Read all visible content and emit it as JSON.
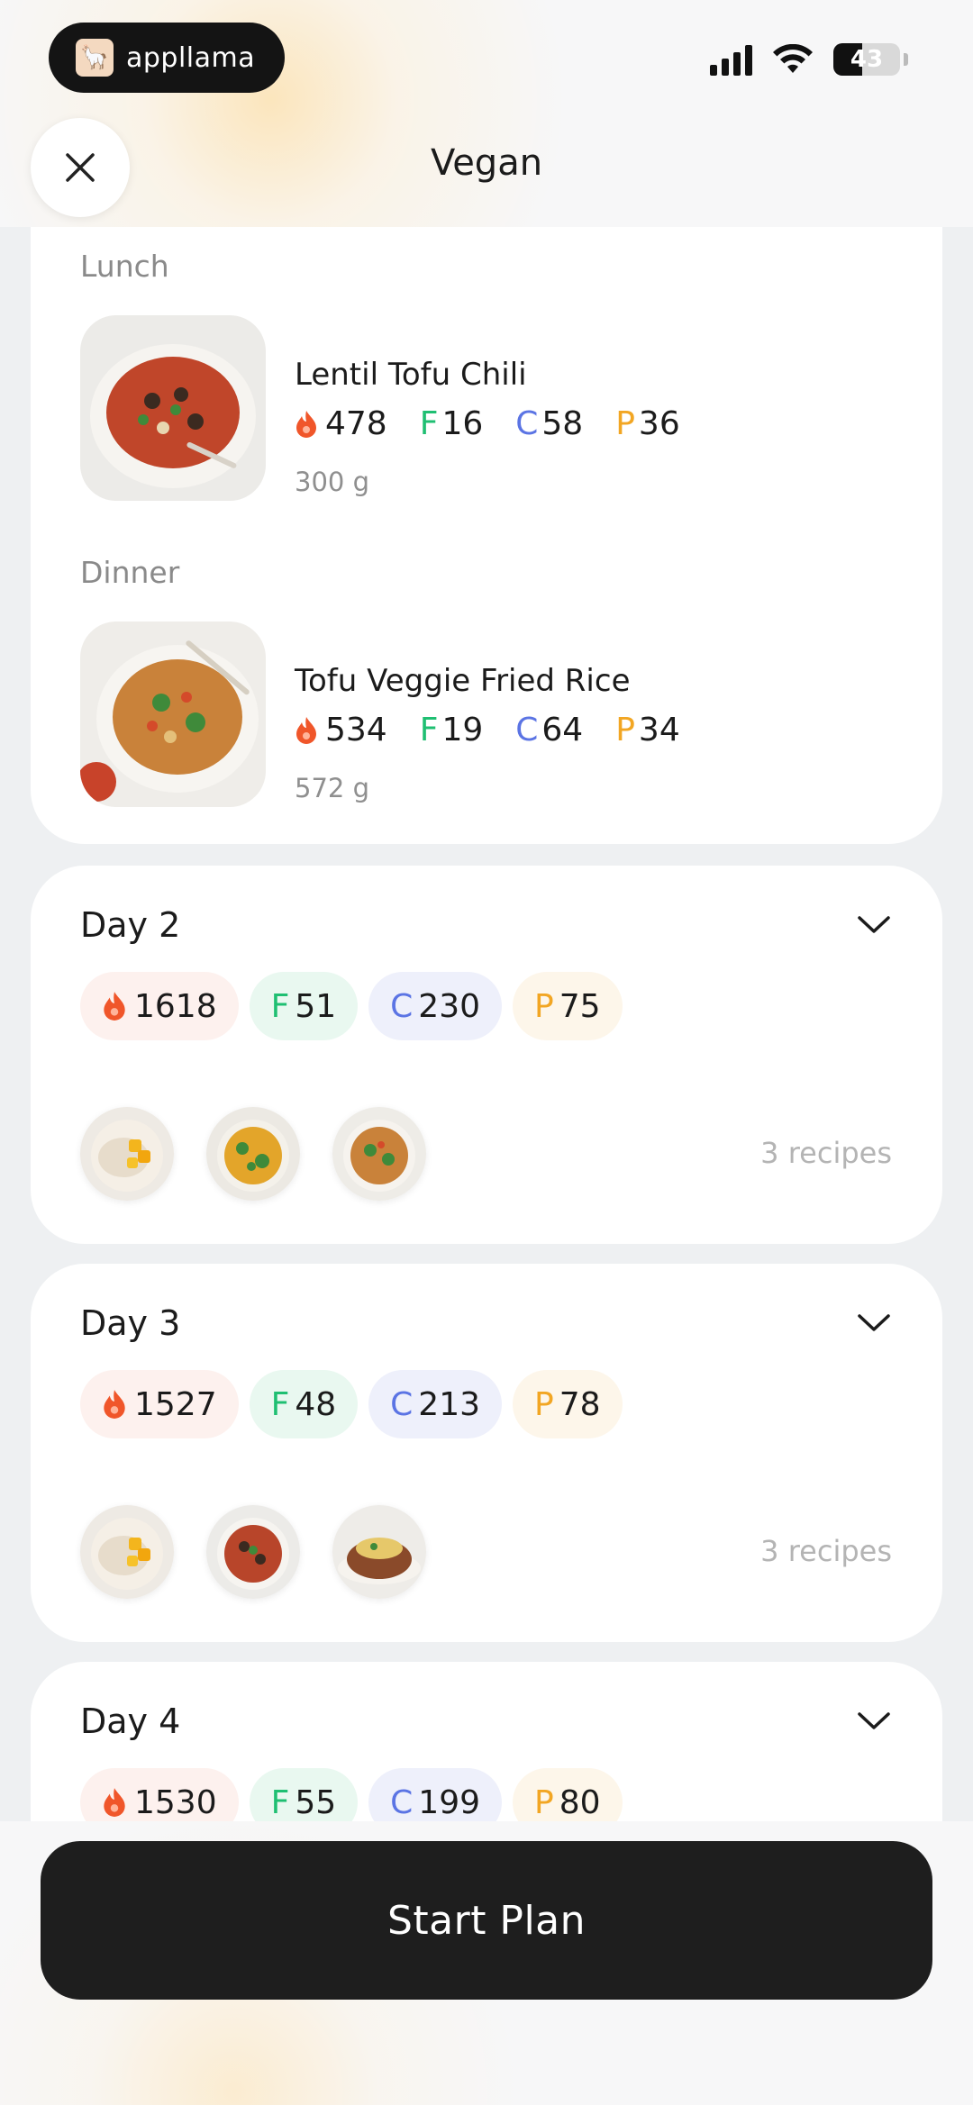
{
  "status_bar": {
    "app_name": "appllama",
    "battery": "43",
    "battery_level": 0.43
  },
  "header": {
    "title": "Vegan"
  },
  "meals": [
    {
      "label": "Lunch",
      "name": "Lentil Tofu Chili",
      "kcal": "478",
      "fat": "16",
      "carbs": "58",
      "protein": "36",
      "weight": "300 g"
    },
    {
      "label": "Dinner",
      "name": "Tofu Veggie Fried Rice",
      "kcal": "534",
      "fat": "19",
      "carbs": "64",
      "protein": "34",
      "weight": "572 g"
    }
  ],
  "macro_letters": {
    "fat": "F",
    "carbs": "C",
    "protein": "P"
  },
  "days": [
    {
      "title": "Day 2",
      "kcal": "1618",
      "fat": "51",
      "carbs": "230",
      "protein": "75",
      "recipes": "3 recipes"
    },
    {
      "title": "Day 3",
      "kcal": "1527",
      "fat": "48",
      "carbs": "213",
      "protein": "78",
      "recipes": "3 recipes"
    },
    {
      "title": "Day 4",
      "kcal": "1530",
      "fat": "55",
      "carbs": "199",
      "protein": "80"
    }
  ],
  "cta": {
    "label": "Start Plan"
  },
  "colors": {
    "fat": "#1fbf72",
    "carbs": "#5b74e4",
    "protein": "#f2a623",
    "flame": "#f0562a"
  }
}
